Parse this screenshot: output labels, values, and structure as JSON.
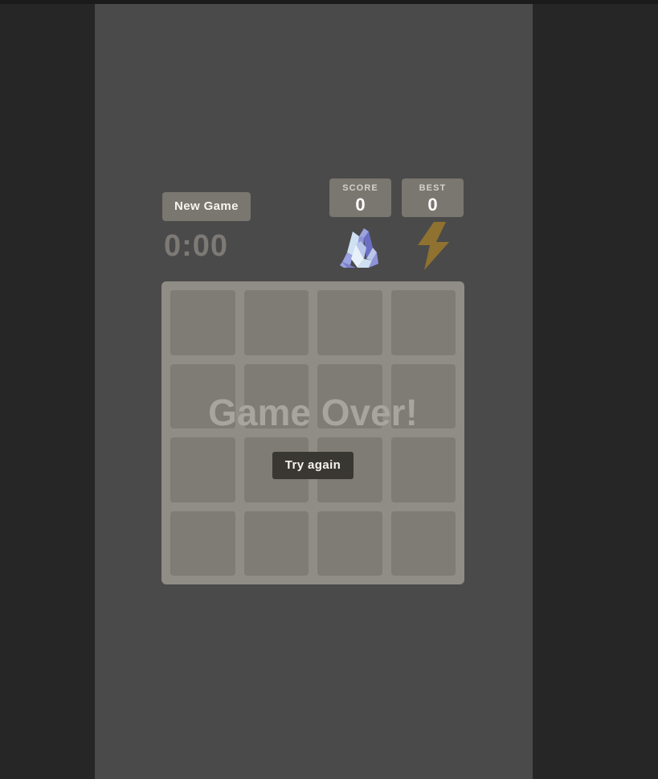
{
  "window": {
    "background_color": "#262626",
    "page_background_color": "#4a4a4a"
  },
  "header": {
    "new_game_label": "New Game",
    "timer": "0:00",
    "scores": [
      {
        "label": "SCORE",
        "value": "0"
      },
      {
        "label": "BEST",
        "value": "0"
      }
    ],
    "icons": [
      {
        "name": "crystal-icon",
        "glyph": "crystal",
        "colors": [
          "#cfe0f2",
          "#6b6fc4",
          "#8e93d8",
          "#e8f1fa"
        ]
      },
      {
        "name": "lightning-bolt-icon",
        "glyph": "bolt",
        "colors": [
          "#8a6d2e",
          "#9c7c35"
        ]
      }
    ]
  },
  "board": {
    "rows": 4,
    "columns": 4,
    "grid_background_color": "#7f7b76",
    "cell_background_color": "#6b6762",
    "cells": [
      "",
      "",
      "",
      "",
      "",
      "",
      "",
      "",
      "",
      "",
      "",
      "",
      "",
      "",
      "",
      ""
    ]
  },
  "game_over": {
    "visible": true,
    "message": "Game Over!",
    "retry_label": "Try again",
    "message_color": "#a8a49e",
    "retry_button_color": "#393731"
  }
}
